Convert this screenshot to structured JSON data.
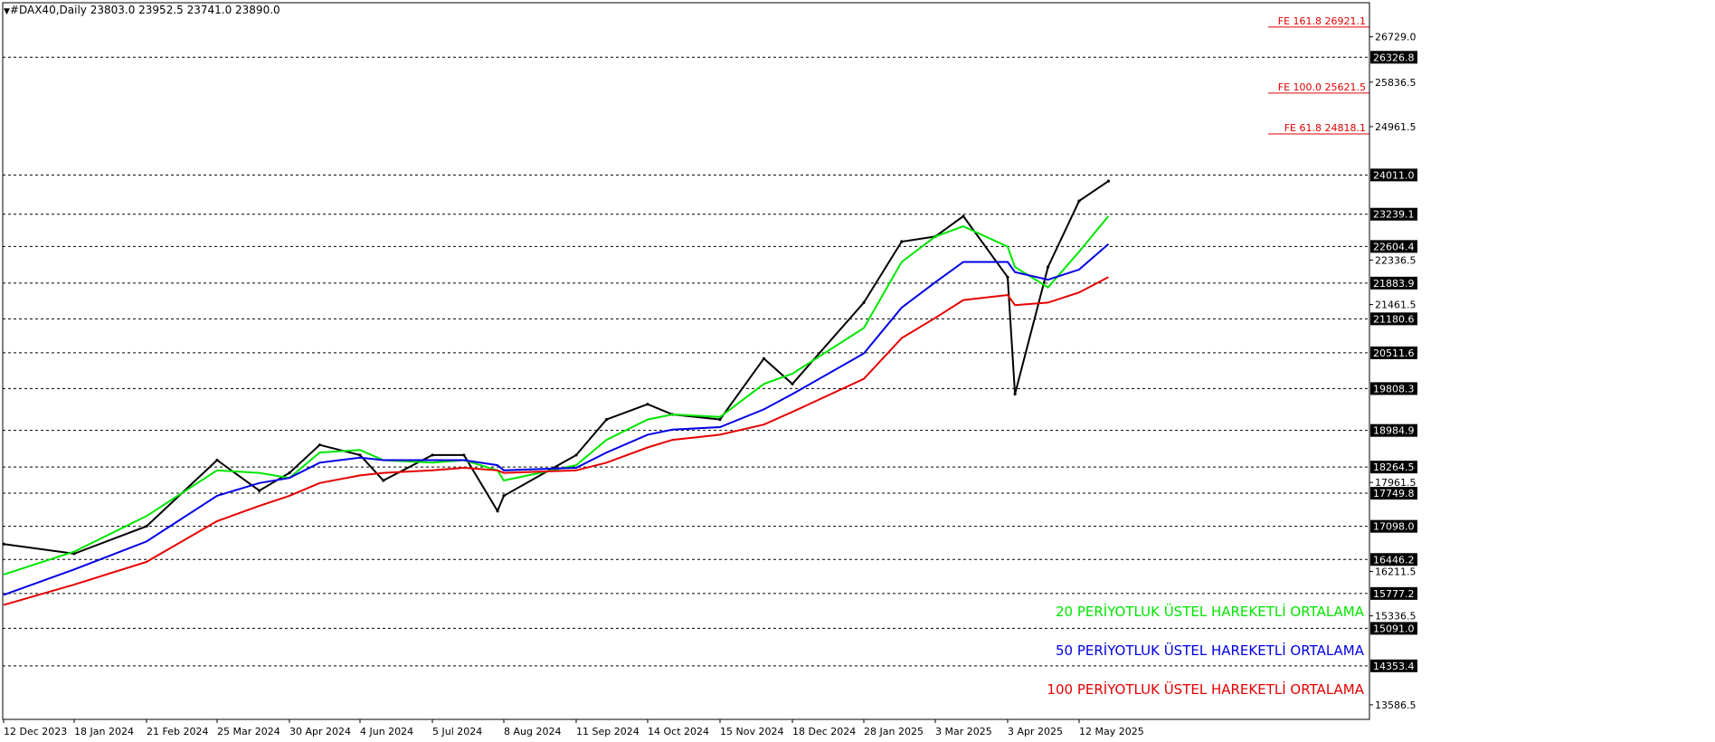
{
  "header": {
    "symbol": "#DAX40,Daily",
    "ohlc": "23803.0 23952.5 23741.0 23890.0"
  },
  "legend": [
    {
      "label": "20 PERİYOTLUK ÜSTEL HAREKETLİ ORTALAMA",
      "color": "#00e600"
    },
    {
      "label": "50 PERİYOTLUK ÜSTEL HAREKETLİ ORTALAMA",
      "color": "#0000e6"
    },
    {
      "label": "100 PERİYOTLUK ÜSTEL HAREKETLİ ORTALAMA",
      "color": "#e60000"
    }
  ],
  "chart_data": {
    "type": "line",
    "instrument": "#DAX40",
    "timeframe": "Daily",
    "ohlc_last": {
      "open": 23803.0,
      "high": 23952.5,
      "low": 23741.0,
      "close": 23890.0
    },
    "ylim": [
      13300,
      27400
    ],
    "x_ticks": [
      "12 Dec 2023",
      "18 Jan 2024",
      "21 Feb 2024",
      "25 Mar 2024",
      "30 Apr 2024",
      "4 Jun 2024",
      "5 Jul 2024",
      "8 Aug 2024",
      "11 Sep 2024",
      "14 Oct 2024",
      "15 Nov 2024",
      "18 Dec 2024",
      "28 Jan 2025",
      "3 Mar 2025",
      "3 Apr 2025",
      "12 May 2025"
    ],
    "y_ticks": [
      "26729.0",
      "25836.5",
      "24961.5",
      "22336.5",
      "21461.5",
      "17961.5",
      "16211.5",
      "15336.5",
      "13586.5"
    ],
    "horizontal_levels": [
      26326.8,
      24011.0,
      23239.1,
      22604.4,
      21883.9,
      21180.6,
      20511.6,
      19808.3,
      18984.9,
      18264.5,
      17749.8,
      17098.0,
      16446.2,
      15777.2,
      15091.0,
      14353.4
    ],
    "horizontal_level_labels": [
      "26326.8",
      "24011.0",
      "23239.1",
      "22604.4",
      "21883.9",
      "21180.6",
      "20511.6",
      "19808.3",
      "18984.9",
      "18264.5",
      "17749.8",
      "17098.0",
      "16446.2",
      "15777.2",
      "15091.0",
      "14353.4"
    ],
    "fibonacci_extensions": [
      {
        "label": "FE 161.8 26921.1",
        "value": 26921.1
      },
      {
        "label": "FE 100.0 25621.5",
        "value": 25621.5
      },
      {
        "label": "FE 61.8 24818.1",
        "value": 24818.1
      }
    ],
    "price_series": [
      {
        "x": "12 Dec 2023",
        "y": 16750
      },
      {
        "x": "18 Jan 2024",
        "y": 16560
      },
      {
        "x": "21 Feb 2024",
        "y": 17100
      },
      {
        "x": "25 Mar 2024",
        "y": 18400
      },
      {
        "x": "15 Apr 2024",
        "y": 17800
      },
      {
        "x": "30 Apr 2024",
        "y": 18150
      },
      {
        "x": "15 May 2024",
        "y": 18700
      },
      {
        "x": "4 Jun 2024",
        "y": 18500
      },
      {
        "x": "14 Jun 2024",
        "y": 18000
      },
      {
        "x": "5 Jul 2024",
        "y": 18500
      },
      {
        "x": "20 Jul 2024",
        "y": 18500
      },
      {
        "x": "5 Aug 2024",
        "y": 17400
      },
      {
        "x": "8 Aug 2024",
        "y": 17700
      },
      {
        "x": "11 Sep 2024",
        "y": 18500
      },
      {
        "x": "25 Sep 2024",
        "y": 19200
      },
      {
        "x": "14 Oct 2024",
        "y": 19500
      },
      {
        "x": "25 Oct 2024",
        "y": 19300
      },
      {
        "x": "15 Nov 2024",
        "y": 19200
      },
      {
        "x": "5 Dec 2024",
        "y": 20400
      },
      {
        "x": "18 Dec 2024",
        "y": 19900
      },
      {
        "x": "28 Jan 2025",
        "y": 21500
      },
      {
        "x": "15 Feb 2025",
        "y": 22700
      },
      {
        "x": "3 Mar 2025",
        "y": 22800
      },
      {
        "x": "15 Mar 2025",
        "y": 23200
      },
      {
        "x": "3 Apr 2025",
        "y": 22000
      },
      {
        "x": "7 Apr 2025",
        "y": 19700
      },
      {
        "x": "25 Apr 2025",
        "y": 22200
      },
      {
        "x": "12 May 2025",
        "y": 23500
      },
      {
        "x": "28 May 2025",
        "y": 23890
      }
    ],
    "series": [
      {
        "name": "20 PERİYOTLUK ÜSTEL HAREKETLİ ORTALAMA",
        "color": "#00e600",
        "values": [
          16150,
          16600,
          17300,
          18200,
          18150,
          18050,
          18550,
          18600,
          18400,
          18350,
          18400,
          18200,
          18000,
          18300,
          18800,
          19200,
          19300,
          19250,
          19900,
          20100,
          21000,
          22300,
          22800,
          23000,
          22600,
          22200,
          21800,
          22500,
          23200
        ]
      },
      {
        "name": "50 PERİYOTLUK ÜSTEL HAREKETLİ ORTALAMA",
        "color": "#0000e6",
        "values": [
          15750,
          16250,
          16800,
          17700,
          17950,
          18050,
          18350,
          18450,
          18400,
          18400,
          18400,
          18300,
          18200,
          18250,
          18550,
          18900,
          19000,
          19050,
          19400,
          19700,
          20500,
          21400,
          21900,
          22300,
          22300,
          22100,
          21950,
          22150,
          22650
        ]
      },
      {
        "name": "100 PERİYOTLUK ÜSTEL HAREKETLİ ORTALAMA",
        "color": "#e60000",
        "values": [
          15550,
          15950,
          16400,
          17200,
          17500,
          17700,
          17950,
          18100,
          18150,
          18200,
          18250,
          18200,
          18150,
          18200,
          18350,
          18650,
          18800,
          18900,
          19100,
          19350,
          20000,
          20800,
          21200,
          21550,
          21650,
          21450,
          21500,
          21700,
          22000
        ]
      }
    ]
  }
}
